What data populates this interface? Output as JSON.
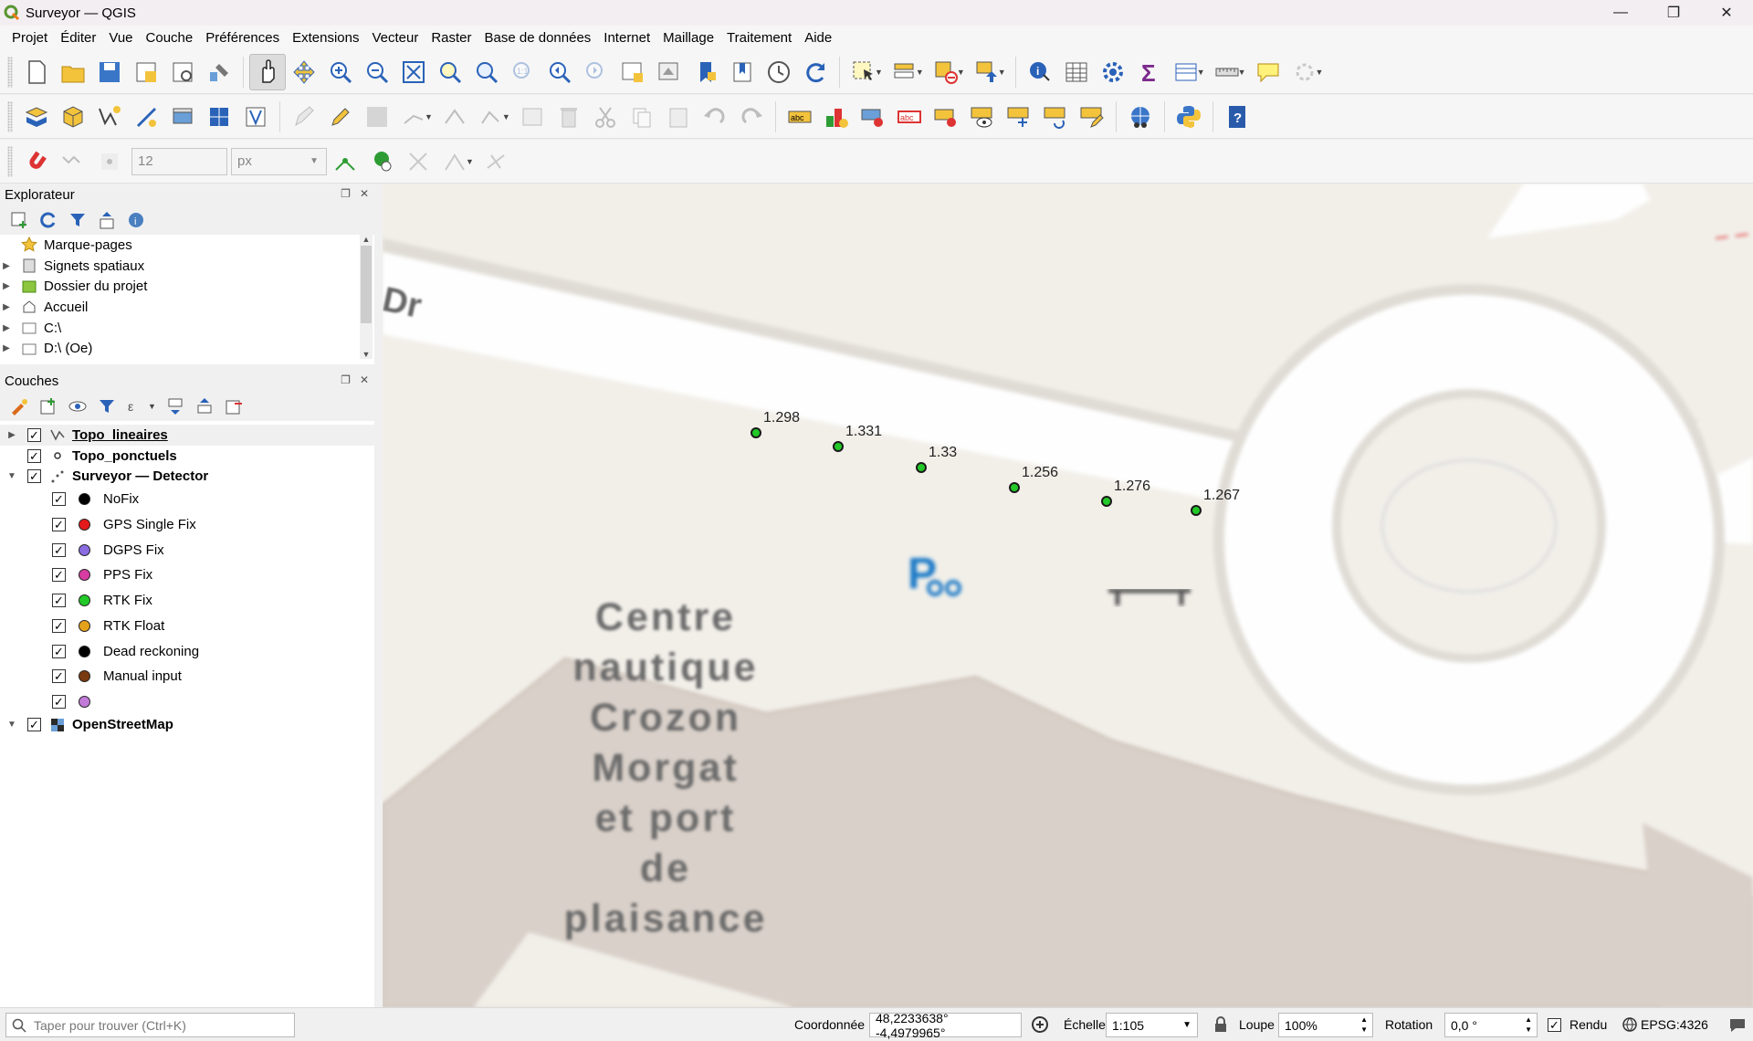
{
  "window": {
    "title": "Surveyor — QGIS"
  },
  "menu": [
    {
      "label": "Projet"
    },
    {
      "label": "Éditer"
    },
    {
      "label": "Vue"
    },
    {
      "label": "Couche"
    },
    {
      "label": "Préférences"
    },
    {
      "label": "Extensions"
    },
    {
      "label": "Vecteur"
    },
    {
      "label": "Raster"
    },
    {
      "label": "Base de données"
    },
    {
      "label": "Internet"
    },
    {
      "label": "Maillage"
    },
    {
      "label": "Traitement"
    },
    {
      "label": "Aide"
    }
  ],
  "snapping": {
    "tolerance": "12",
    "unit": "px"
  },
  "browser": {
    "title": "Explorateur",
    "items": [
      {
        "label": "Marque-pages",
        "icon": "star-icon"
      },
      {
        "label": "Signets spatiaux",
        "icon": "bookmark-icon"
      },
      {
        "label": "Dossier du projet",
        "icon": "project-folder-icon"
      },
      {
        "label": "Accueil",
        "icon": "home-icon"
      },
      {
        "label": "C:\\",
        "icon": "folder-icon"
      },
      {
        "label": "D:\\ (Oe)",
        "icon": "folder-icon"
      }
    ]
  },
  "layers": {
    "title": "Couches",
    "items": [
      {
        "label": "Topo_lineaires",
        "icon": "line-layer-icon"
      },
      {
        "label": "Topo_ponctuels",
        "icon": "point-layer-icon"
      },
      {
        "label": "Surveyor — Detector",
        "icon": "point-layer-icon"
      },
      {
        "label": "OpenStreetMap",
        "icon": "raster-layer-icon"
      }
    ],
    "legend": [
      {
        "label": "NoFix",
        "color": "#000000"
      },
      {
        "label": "GPS Single Fix",
        "color": "#e31a1c"
      },
      {
        "label": "DGPS Fix",
        "color": "#8a6be0"
      },
      {
        "label": "PPS Fix",
        "color": "#d63ca2"
      },
      {
        "label": "RTK Fix",
        "color": "#22c928"
      },
      {
        "label": "RTK Float",
        "color": "#e4a11b"
      },
      {
        "label": "Dead reckoning",
        "color": "#000000"
      },
      {
        "label": "Manual input",
        "color": "#7a3a10"
      },
      {
        "label": "",
        "color": "#c27ad8"
      }
    ]
  },
  "map": {
    "points": [
      "1.298",
      "1.331",
      "1.33",
      "1.256",
      "1.276",
      "1.267"
    ],
    "road_label": "Dr",
    "area_label": [
      "Centre",
      "nautique",
      "Crozon",
      "Morgat",
      "et port",
      "de plaisance"
    ]
  },
  "status": {
    "search_placeholder": "Taper pour trouver (Ctrl+K)",
    "coord_label": "Coordonnée",
    "coord_value": "48,2233638° -4,4979965°",
    "scale_label": "Échelle",
    "scale_value": "1:105",
    "magnifier_label": "Loupe",
    "magnifier_value": "100%",
    "rotation_label": "Rotation",
    "rotation_value": "0,0 °",
    "render_label": "Rendu",
    "crs": "EPSG:4326"
  }
}
